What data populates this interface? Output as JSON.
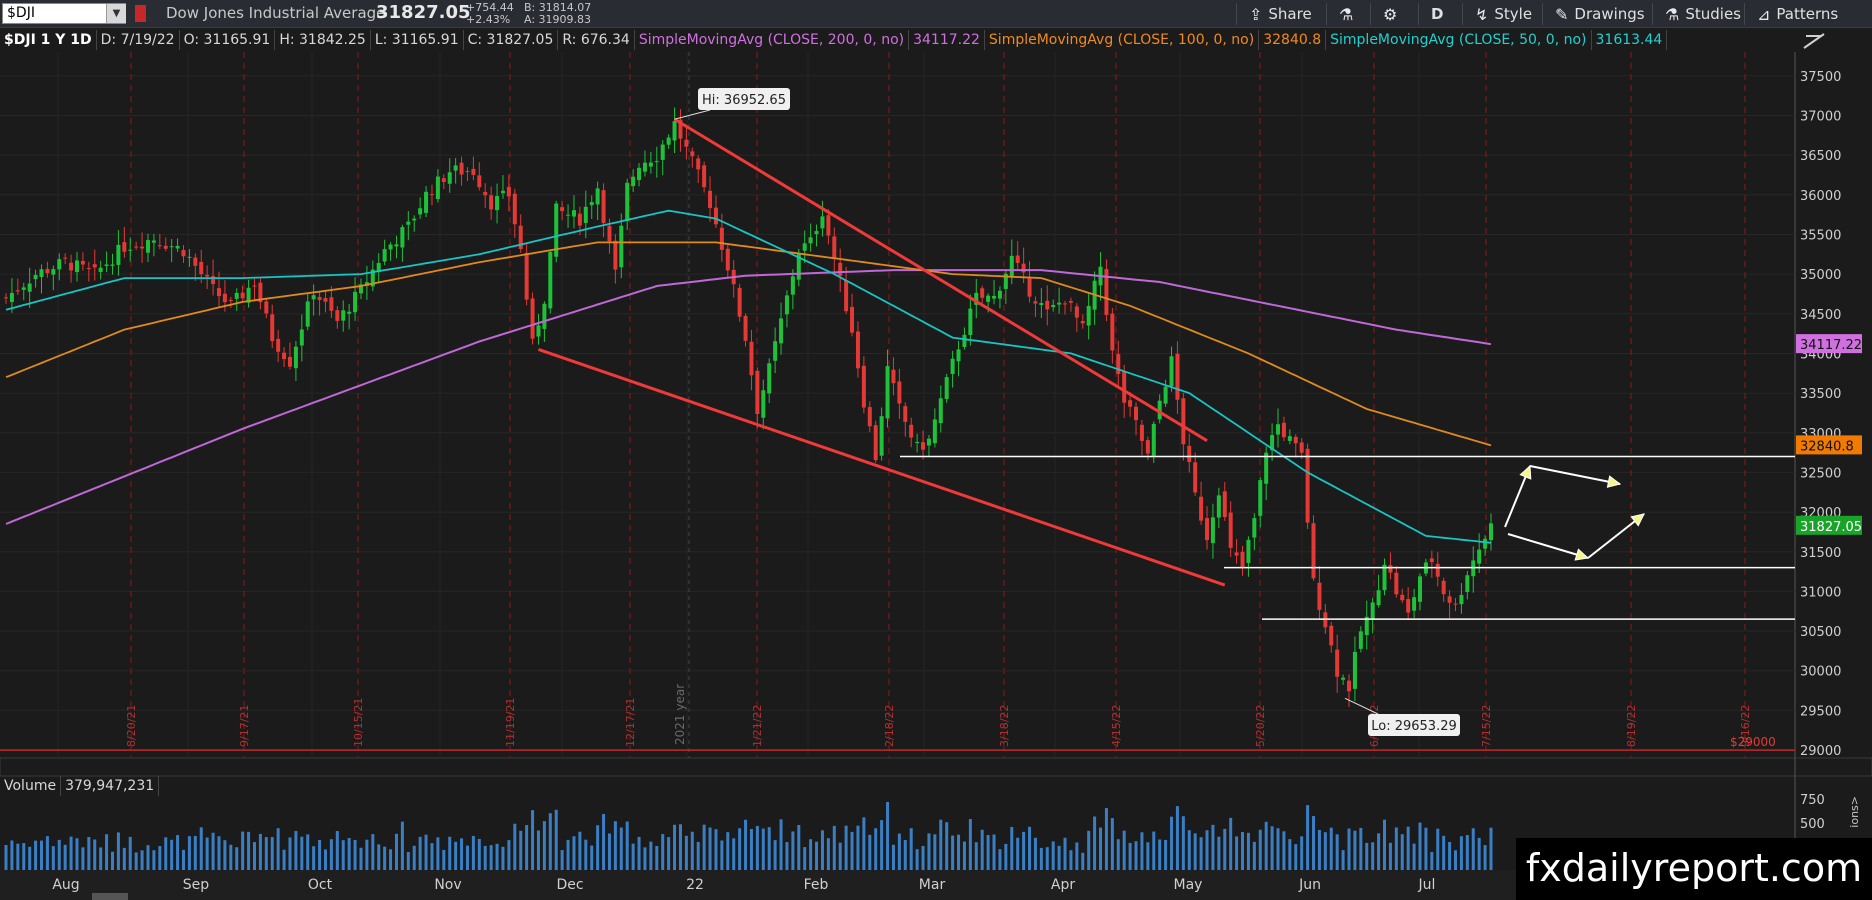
{
  "toolbar": {
    "symbol": "$DJI",
    "symbol_dropdown": "▼",
    "instrument_name": "Dow Jones Industrial Average",
    "last": "31827.05",
    "change_abs": "+754.44",
    "change_pct": "+2.43%",
    "bid": "B: 31814.07",
    "ask": "A: 31909.83",
    "share_label": "Share",
    "timeframe_label": "D",
    "style_label": "Style",
    "drawings_label": "Drawings",
    "studies_label": "Studies",
    "patterns_label": "Patterns"
  },
  "infobar": {
    "symbol": "$DJI 1 Y 1D",
    "date": "D: 7/19/22",
    "open": "O: 31165.91",
    "high": "H: 31842.25",
    "low": "L: 31165.91",
    "close": "C: 31827.05",
    "range": "R: 676.34",
    "sma200_label": "SimpleMovingAvg (CLOSE, 200, 0, no)",
    "sma200_value": "34117.22",
    "sma100_label": "SimpleMovingAvg (CLOSE, 100, 0, no)",
    "sma100_value": "32840.8",
    "sma50_label": "SimpleMovingAvg (CLOSE, 50, 0, no)",
    "sma50_value": "31613.44"
  },
  "volume": {
    "label": "Volume",
    "value": "379,947,231",
    "ticks": [
      "750",
      "500"
    ]
  },
  "watermark": "fxdailyreport.com",
  "side_tab": "ions>",
  "chart_data": {
    "type": "candlestick",
    "title": "",
    "price_ticks": [
      37500,
      37000,
      36500,
      36000,
      35500,
      35000,
      34500,
      34000,
      33500,
      33000,
      32500,
      32000,
      31500,
      31000,
      30500,
      30000,
      29500,
      29000
    ],
    "ylim": [
      28900,
      37800
    ],
    "month_labels": [
      "Aug",
      "Sep",
      "Oct",
      "Nov",
      "Dec",
      "22",
      "Feb",
      "Mar",
      "Apr",
      "May",
      "Jun",
      "Jul"
    ],
    "expiry_labels": [
      "8/20/21",
      "9/17/21",
      "10/15/21",
      "11/19/21",
      "12/17/21",
      "1/21/22",
      "2/18/22",
      "3/18/22",
      "4/15/22",
      "5/20/22",
      "6/17/22",
      "7/15/22",
      "8/19/22",
      "9/16/22"
    ],
    "year_marker": "2021 year",
    "hi_label": "Hi: 36952.65",
    "lo_label": "Lo: 29653.29",
    "level_line_label": "$29000",
    "badges": {
      "sma200": {
        "text": "34117.22",
        "value": 34117.22,
        "color": "#d070e0"
      },
      "sma100": {
        "text": "32840.8",
        "value": 32840.8,
        "color": "#f07b00"
      },
      "last": {
        "text": "31827.05",
        "value": 31827.05,
        "color": "#1aa329"
      }
    },
    "colors": {
      "up": "#1ec23a",
      "down": "#e53935",
      "sma50": "#18c4c4",
      "sma100": "#e08a1e",
      "sma200": "#c068d8",
      "trend": "#f03a3a",
      "level": "#ffffff",
      "arrow": "#ffffff"
    },
    "close_anchors": [
      [
        0,
        34700
      ],
      [
        5,
        35000
      ],
      [
        10,
        35150
      ],
      [
        15,
        35000
      ],
      [
        20,
        35350
      ],
      [
        25,
        35450
      ],
      [
        30,
        35300
      ],
      [
        35,
        34800
      ],
      [
        38,
        34600
      ],
      [
        42,
        34900
      ],
      [
        45,
        34200
      ],
      [
        48,
        33900
      ],
      [
        52,
        34800
      ],
      [
        56,
        34400
      ],
      [
        60,
        34800
      ],
      [
        64,
        35300
      ],
      [
        68,
        35600
      ],
      [
        71,
        36000
      ],
      [
        75,
        36300
      ],
      [
        79,
        36300
      ],
      [
        82,
        35900
      ],
      [
        85,
        36000
      ],
      [
        87,
        35300
      ],
      [
        89,
        34100
      ],
      [
        91,
        34700
      ],
      [
        93,
        35800
      ],
      [
        97,
        35700
      ],
      [
        100,
        36100
      ],
      [
        103,
        35000
      ],
      [
        105,
        36100
      ],
      [
        107,
        36400
      ],
      [
        110,
        36500
      ],
      [
        113,
        36900
      ],
      [
        116,
        36400
      ],
      [
        119,
        35900
      ],
      [
        122,
        35100
      ],
      [
        125,
        34200
      ],
      [
        127,
        33300
      ],
      [
        129,
        33800
      ],
      [
        132,
        34700
      ],
      [
        134,
        35300
      ],
      [
        136,
        35400
      ],
      [
        138,
        35800
      ],
      [
        140,
        35200
      ],
      [
        143,
        34300
      ],
      [
        145,
        33400
      ],
      [
        147,
        32700
      ],
      [
        149,
        33800
      ],
      [
        151,
        33300
      ],
      [
        154,
        32800
      ],
      [
        156,
        32900
      ],
      [
        158,
        33400
      ],
      [
        161,
        34100
      ],
      [
        164,
        34700
      ],
      [
        167,
        34700
      ],
      [
        170,
        35200
      ],
      [
        173,
        34800
      ],
      [
        176,
        34500
      ],
      [
        179,
        34700
      ],
      [
        182,
        34300
      ],
      [
        185,
        35100
      ],
      [
        187,
        34000
      ],
      [
        189,
        33400
      ],
      [
        191,
        33100
      ],
      [
        193,
        32700
      ],
      [
        195,
        33400
      ],
      [
        197,
        33900
      ],
      [
        199,
        32900
      ],
      [
        201,
        32200
      ],
      [
        203,
        31700
      ],
      [
        205,
        32300
      ],
      [
        207,
        31500
      ],
      [
        209,
        31300
      ],
      [
        211,
        31900
      ],
      [
        213,
        32800
      ],
      [
        215,
        33100
      ],
      [
        217,
        32900
      ],
      [
        219,
        32700
      ],
      [
        221,
        31100
      ],
      [
        223,
        30600
      ],
      [
        225,
        30000
      ],
      [
        227,
        29800
      ],
      [
        229,
        30500
      ],
      [
        231,
        30800
      ],
      [
        233,
        31400
      ],
      [
        235,
        31000
      ],
      [
        237,
        30700
      ],
      [
        239,
        31200
      ],
      [
        241,
        31400
      ],
      [
        243,
        31000
      ],
      [
        245,
        30800
      ],
      [
        247,
        31250
      ],
      [
        249,
        31550
      ],
      [
        251,
        31827
      ]
    ],
    "sma50_anchors": [
      [
        0,
        34550
      ],
      [
        20,
        34950
      ],
      [
        40,
        34950
      ],
      [
        60,
        35000
      ],
      [
        80,
        35250
      ],
      [
        100,
        35600
      ],
      [
        112,
        35800
      ],
      [
        120,
        35700
      ],
      [
        140,
        35000
      ],
      [
        160,
        34200
      ],
      [
        180,
        34000
      ],
      [
        200,
        33500
      ],
      [
        220,
        32500
      ],
      [
        240,
        31700
      ],
      [
        251,
        31613
      ]
    ],
    "sma100_anchors": [
      [
        0,
        33700
      ],
      [
        20,
        34300
      ],
      [
        40,
        34650
      ],
      [
        60,
        34850
      ],
      [
        80,
        35150
      ],
      [
        100,
        35400
      ],
      [
        120,
        35400
      ],
      [
        140,
        35200
      ],
      [
        160,
        35000
      ],
      [
        175,
        34950
      ],
      [
        190,
        34600
      ],
      [
        210,
        34000
      ],
      [
        230,
        33300
      ],
      [
        251,
        32841
      ]
    ],
    "sma200_anchors": [
      [
        0,
        31850
      ],
      [
        20,
        32450
      ],
      [
        40,
        33050
      ],
      [
        60,
        33600
      ],
      [
        80,
        34150
      ],
      [
        95,
        34500
      ],
      [
        110,
        34850
      ],
      [
        125,
        34980
      ],
      [
        150,
        35050
      ],
      [
        175,
        35050
      ],
      [
        195,
        34900
      ],
      [
        215,
        34600
      ],
      [
        235,
        34300
      ],
      [
        251,
        34117
      ]
    ]
  }
}
